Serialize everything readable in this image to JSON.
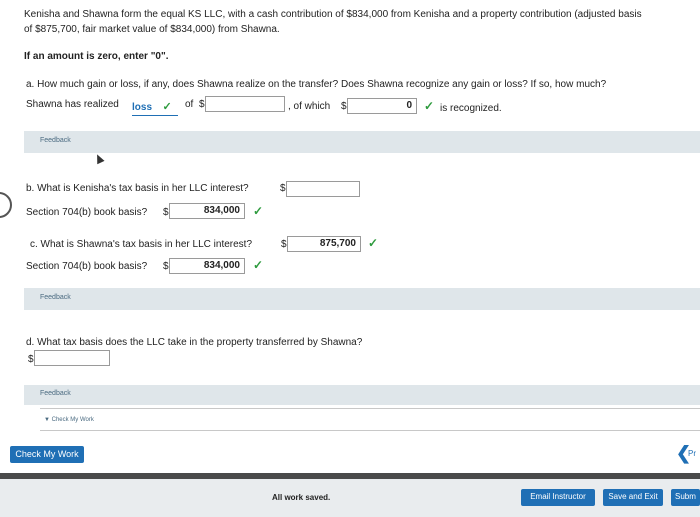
{
  "question": {
    "intro_line1": "Kenisha and Shawna form the equal KS LLC, with a cash contribution of $834,000 from Kenisha and a property contribution (adjusted basis",
    "intro_line2": "of $875,700, fair market value of $834,000) from Shawna.",
    "zero_note": "If an amount is zero, enter \"0\"."
  },
  "part_a": {
    "question": "a.  How much gain or loss, if any, does Shawna realize on the transfer? Does Shawna recognize any gain or loss? If so, how much?",
    "realized_label": "Shawna has realized",
    "realized_select": "loss",
    "of_label": "of",
    "dollar": "$",
    "amount_value": "",
    "of_which_label": ", of which",
    "recognized_value": "0",
    "recognized_label": "is recognized."
  },
  "feedback_label": "Feedback",
  "part_b": {
    "question": "b.  What is Kenisha's tax basis in her LLC interest?",
    "dollar": "$",
    "basis_value": "",
    "book_label": "Section 704(b) book basis?",
    "book_value": "834,000"
  },
  "part_c": {
    "question": "c.   What is Shawna's tax basis in her LLC interest?",
    "dollar": "$",
    "basis_value": "875,700",
    "book_label": "Section 704(b) book basis?",
    "book_value": "834,000"
  },
  "part_d": {
    "question": "d.  What tax basis does the LLC take in the property transferred by Shawna?",
    "dollar": "$",
    "value": ""
  },
  "check_my_work_link": "Check My Work",
  "check_my_work_button": "Check My Work",
  "footer": {
    "status": "All work saved.",
    "email_button": "Email Instructor",
    "save_exit_button": "Save and Exit",
    "submit_button": "Subm",
    "prev_label": "Pr"
  },
  "colors": {
    "check": "#2e9b3e",
    "button_blue": "#1f6fb5",
    "feedback_bar": "#dfe6ea"
  }
}
